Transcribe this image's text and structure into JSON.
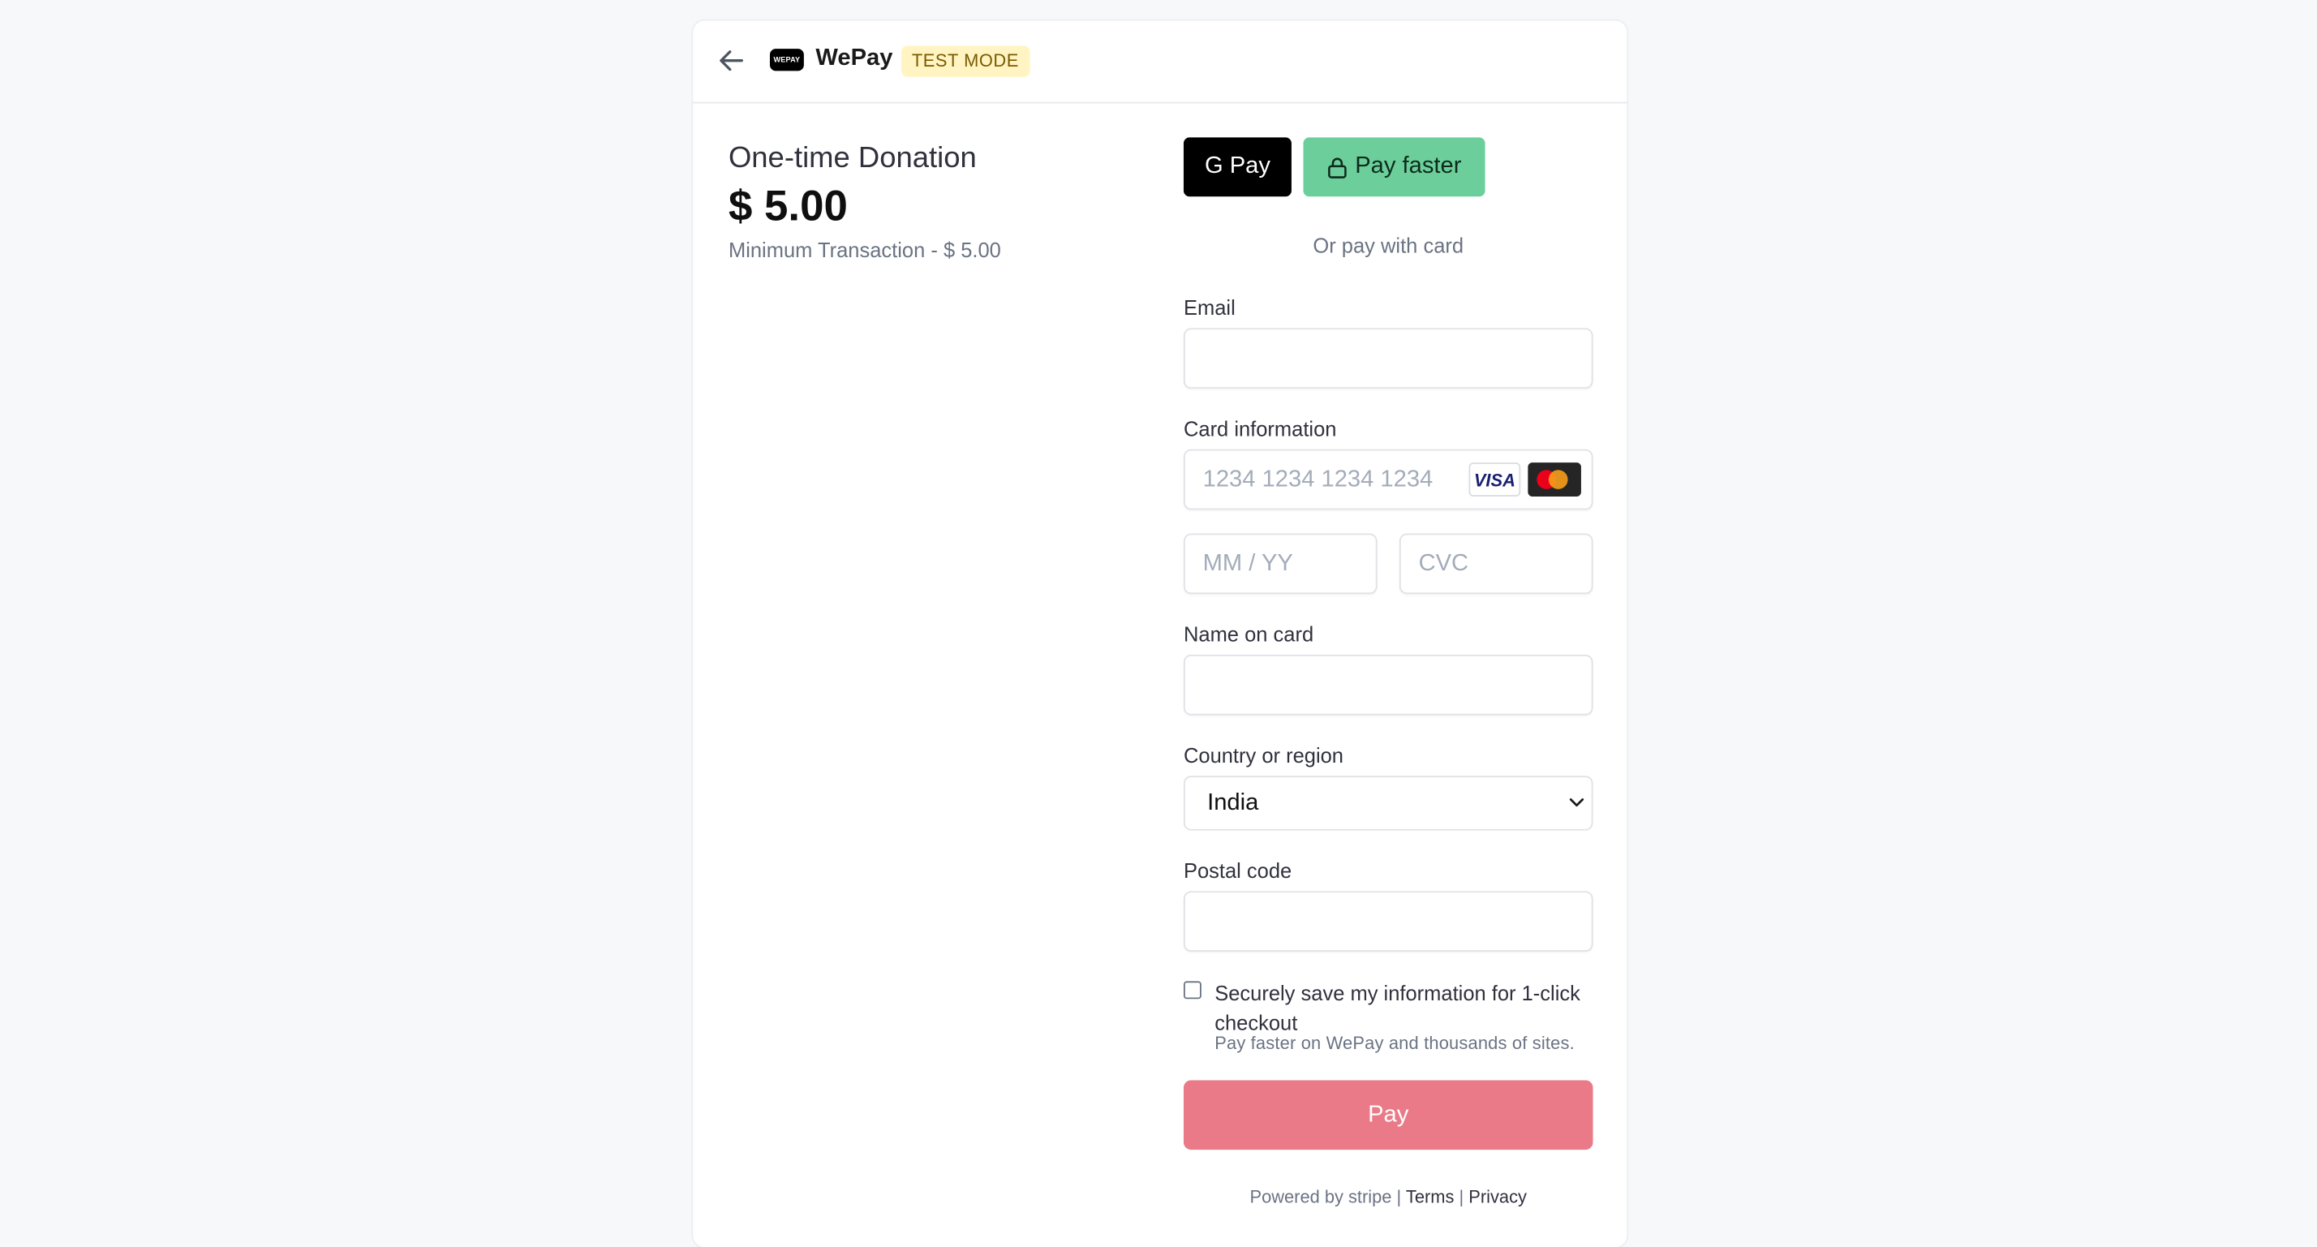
{
  "header": {
    "brand_name": "WePay",
    "logo_text": "WEPAY",
    "test_mode_badge": "TEST MODE"
  },
  "summary": {
    "title": "One-time Donation",
    "amount": "$ 5.00",
    "minimum_note": "Minimum Transaction - $ 5.00"
  },
  "wallets": {
    "gpay_label": "G Pay",
    "pay_faster_label": "Pay faster",
    "divider_text": "Or pay with card"
  },
  "form": {
    "email_label": "Email",
    "email_value": "",
    "card_label": "Card information",
    "card_number_placeholder": "1234 1234 1234 1234",
    "visa_text": "VISA",
    "expiry_placeholder": "MM / YY",
    "cvc_placeholder": "CVC",
    "name_label": "Name on card",
    "name_value": "",
    "country_label": "Country or region",
    "country_value": "India",
    "postal_label": "Postal code",
    "postal_value": "",
    "save_info_label": "Securely save my information for 1-click checkout",
    "save_info_sub": "Pay faster on WePay and thousands of sites.",
    "save_info_checked": false,
    "pay_button": "Pay"
  },
  "footer": {
    "powered_by": "Powered by stripe |",
    "terms": "Terms",
    "separator": "|",
    "privacy": "Privacy"
  },
  "colors": {
    "pay_button": "#ea7a87",
    "pay_faster": "#6ccf9b",
    "test_mode_bg": "#fff4c2"
  }
}
